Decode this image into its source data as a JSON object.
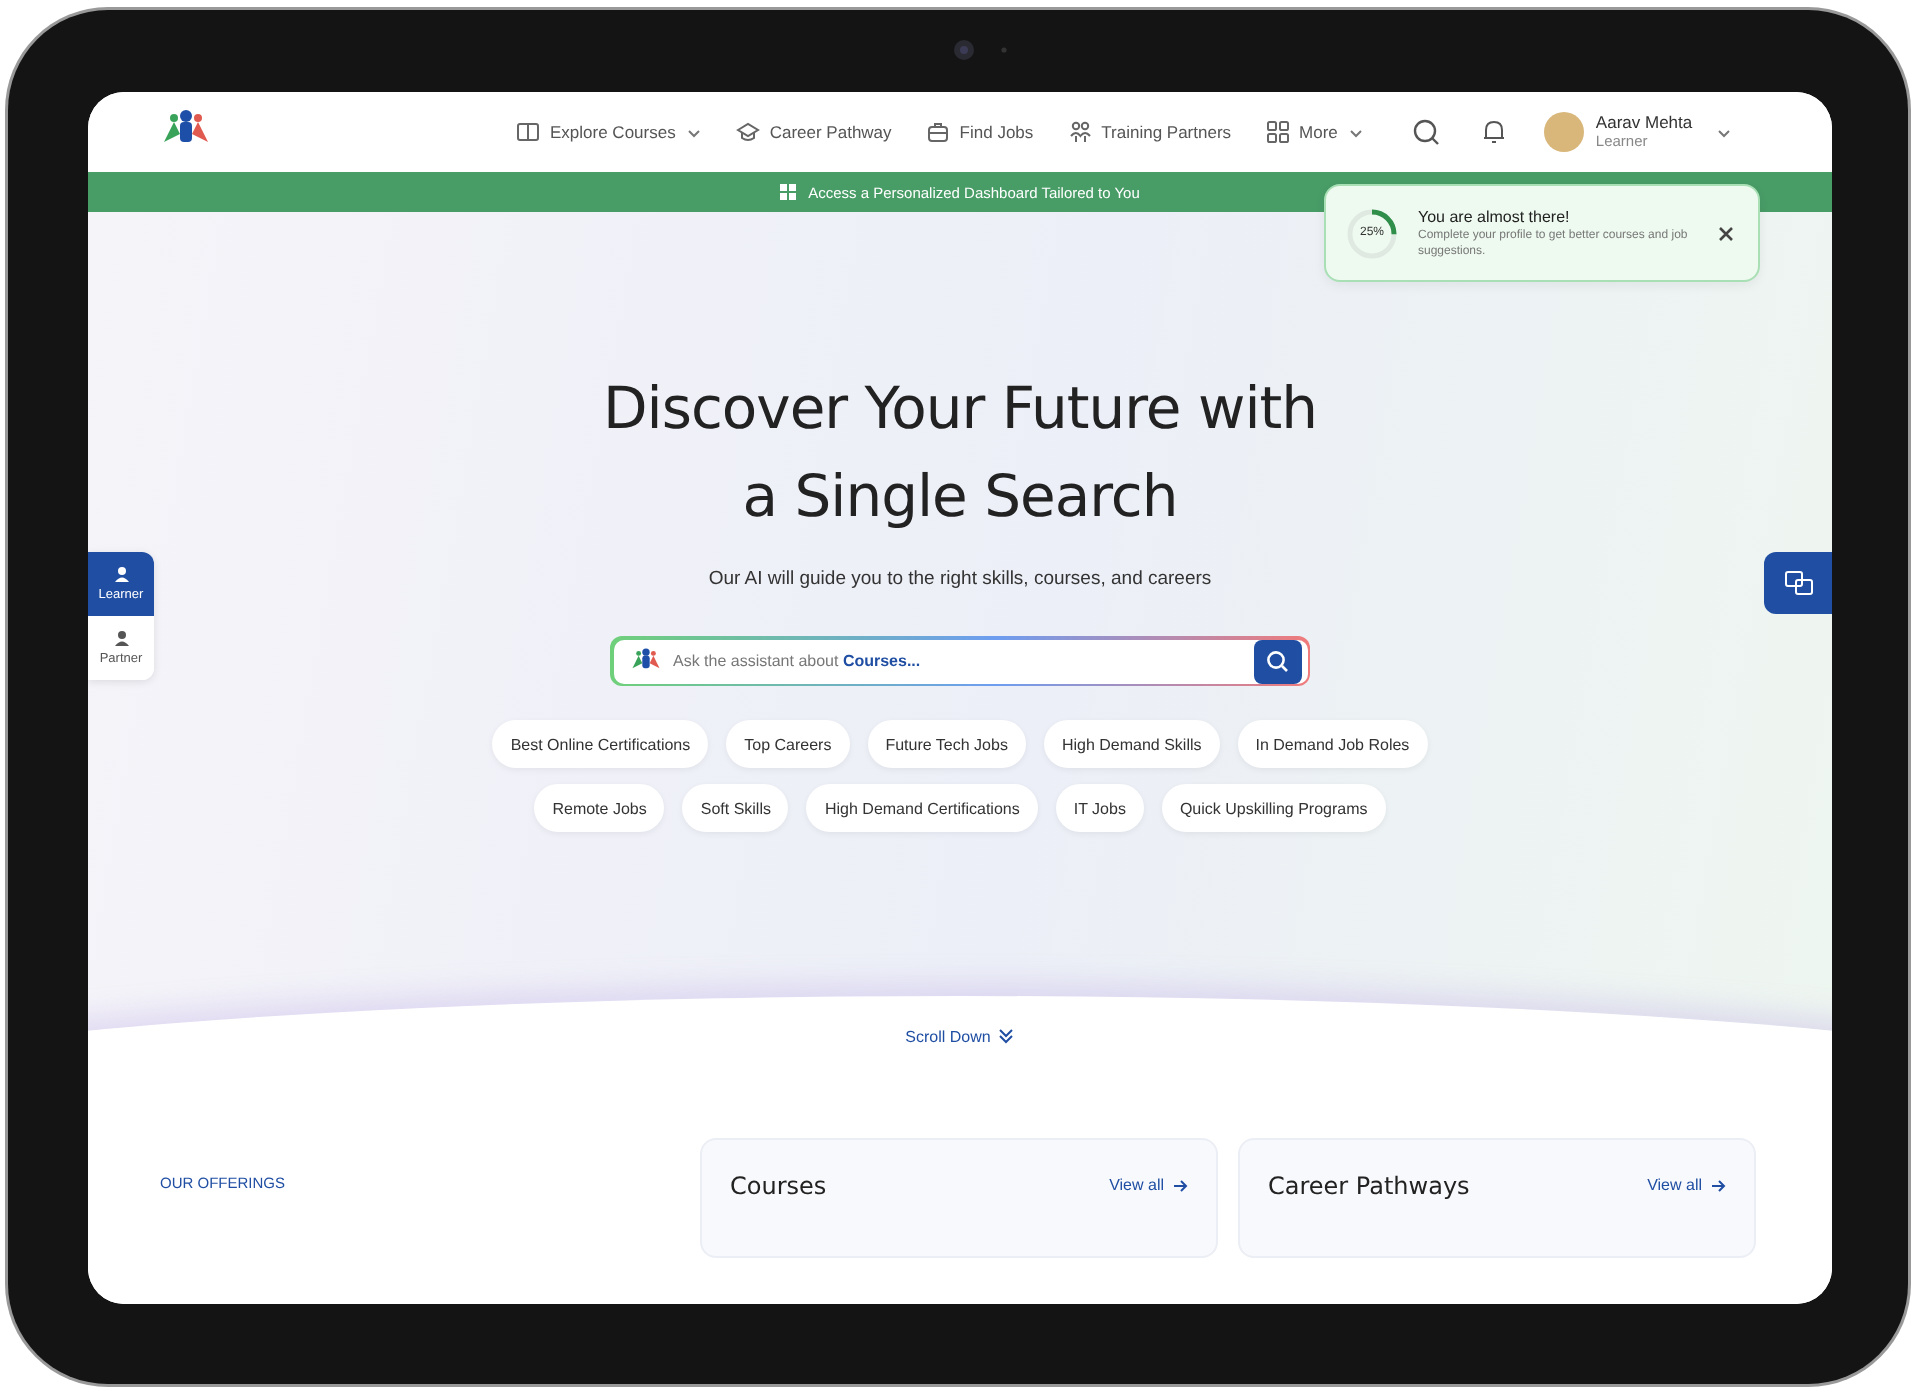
{
  "header": {
    "nav": [
      {
        "label": "Explore Courses",
        "dropdown": true
      },
      {
        "label": "Career Pathway",
        "dropdown": false
      },
      {
        "label": "Find Jobs",
        "dropdown": false
      },
      {
        "label": "Training Partners",
        "dropdown": false
      },
      {
        "label": "More",
        "dropdown": true
      }
    ],
    "user": {
      "name": "Aarav Mehta",
      "role": "Learner"
    }
  },
  "banner": {
    "text": "Access a Personalized Dashboard Tailored to You"
  },
  "toast": {
    "percent": "25%",
    "level": 0.25,
    "title": "You are almost there!",
    "message": "Complete your profile to get better courses and job suggestions."
  },
  "side_tabs": [
    {
      "label": "Learner",
      "selected": true
    },
    {
      "label": "Partner",
      "selected": false
    }
  ],
  "hero": {
    "title_lines": [
      "Discover Your Future with",
      "a Single Search"
    ],
    "subtitle": "Our AI will guide you to the right skills, courses, and careers",
    "search": {
      "placeholder": "Ask the assistant about **Courses...**"
    },
    "chip_rows": [
      [
        "Best Online Certifications",
        "Top Careers",
        "Future Tech Jobs",
        "High Demand Skills",
        "In Demand Job Roles"
      ],
      [
        "Remote Jobs",
        "Soft Skills",
        "High Demand Certifications",
        "IT Jobs",
        "Quick Upskilling Programs"
      ]
    ]
  },
  "scroll_hint": "Scroll Down",
  "offerings": {
    "eyebrow": "OUR OFFERINGS",
    "cards": [
      {
        "title": "Courses",
        "link": "View all"
      },
      {
        "title": "Career Pathways",
        "link": "View all"
      }
    ]
  }
}
